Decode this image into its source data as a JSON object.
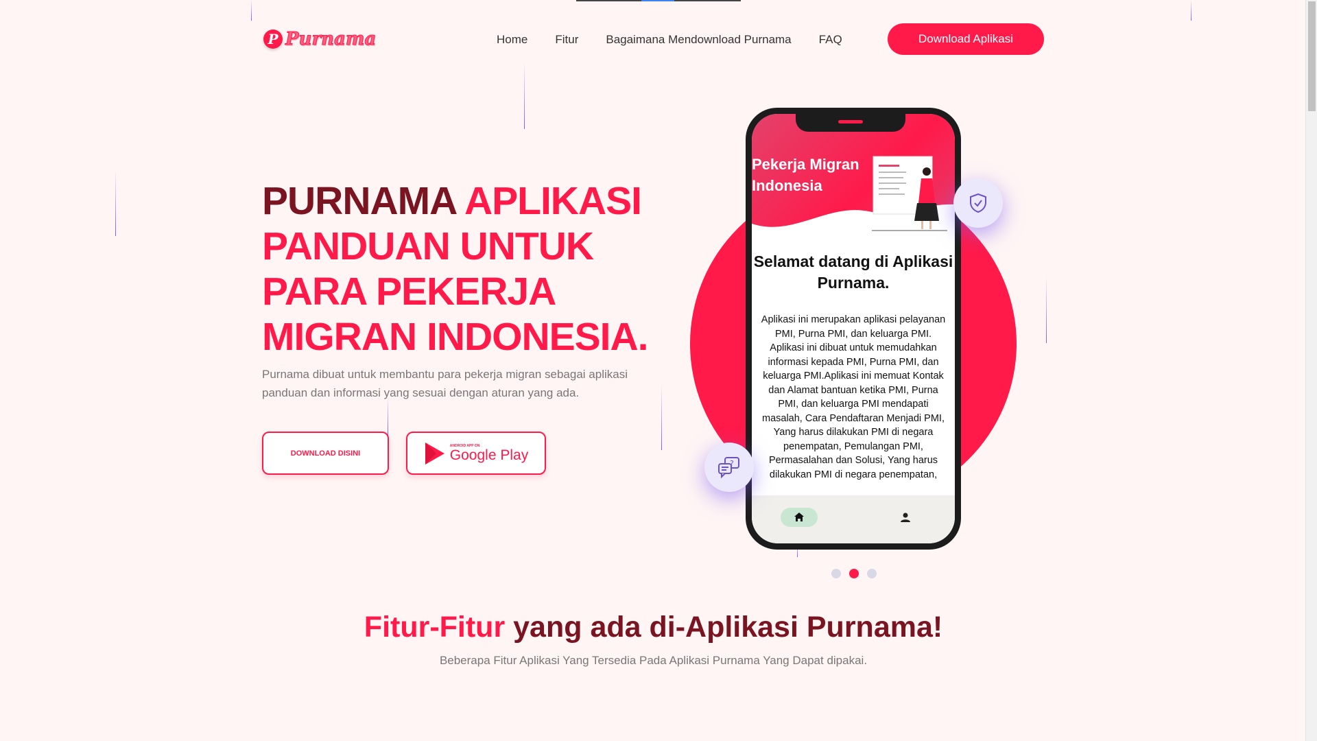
{
  "brand": {
    "name": "Purnama",
    "mark": "P",
    "primary_color": "#ff1a4a",
    "dark_color": "#7a1420",
    "accent_purple": "#7b5cf0"
  },
  "nav": {
    "items": [
      {
        "label": "Home"
      },
      {
        "label": "Fitur"
      },
      {
        "label": "Bagaimana Mendownload Purnama"
      },
      {
        "label": "FAQ"
      }
    ],
    "cta_label": "Download Aplikasi"
  },
  "hero": {
    "title_dark": "PURNAMA ",
    "title_accent": "APLIKASI PANDUAN UNTUK PARA PEKERJA MIGRAN INDONESIA.",
    "description": "Purnama dibuat untuk membantu para pekerja migran sebagai aplikasi panduan dan informasi yang sesuai dengan aturan yang ada.",
    "download_button": "DOWNLOAD DISINI",
    "gplay_small": "ANDROID APP ON",
    "gplay_big": "Google Play"
  },
  "phone": {
    "header": "Pekerja Migran Indonesia",
    "welcome": "Selamat datang di Aplikasi Purnama.",
    "body": "Aplikasi ini merupakan aplikasi pelayanan PMI, Purna PMI, dan keluarga PMI. Aplikasi ini dibuat untuk memudahkan informasi kepada PMI, Purna PMI, dan keluarga PMI.Aplikasi ini memuat Kontak dan Alamat bantuan ketika PMI, Purna PMI, dan keluarga PMI mendapati masalah, Cara Pendaftaran Menjadi PMI, Yang harus dilakukan PMI di negara penempatan, Pemulangan PMI, Permasalahan dan Solusi, Yang harus dilakukan PMI di negara penempatan,",
    "nav_icons": [
      "home-icon",
      "person-icon"
    ]
  },
  "float_icons": [
    "shield-check-icon",
    "chat-question-icon"
  ],
  "carousel": {
    "count": 3,
    "active_index": 1
  },
  "features": {
    "title_accent": "Fitur-Fitur",
    "title_rest": " yang ada di-Aplikasi Purnama!",
    "subtitle": "Beberapa Fitur Aplikasi Yang Tersedia Pada Aplikasi Purnama Yang Dapat dipakai."
  }
}
